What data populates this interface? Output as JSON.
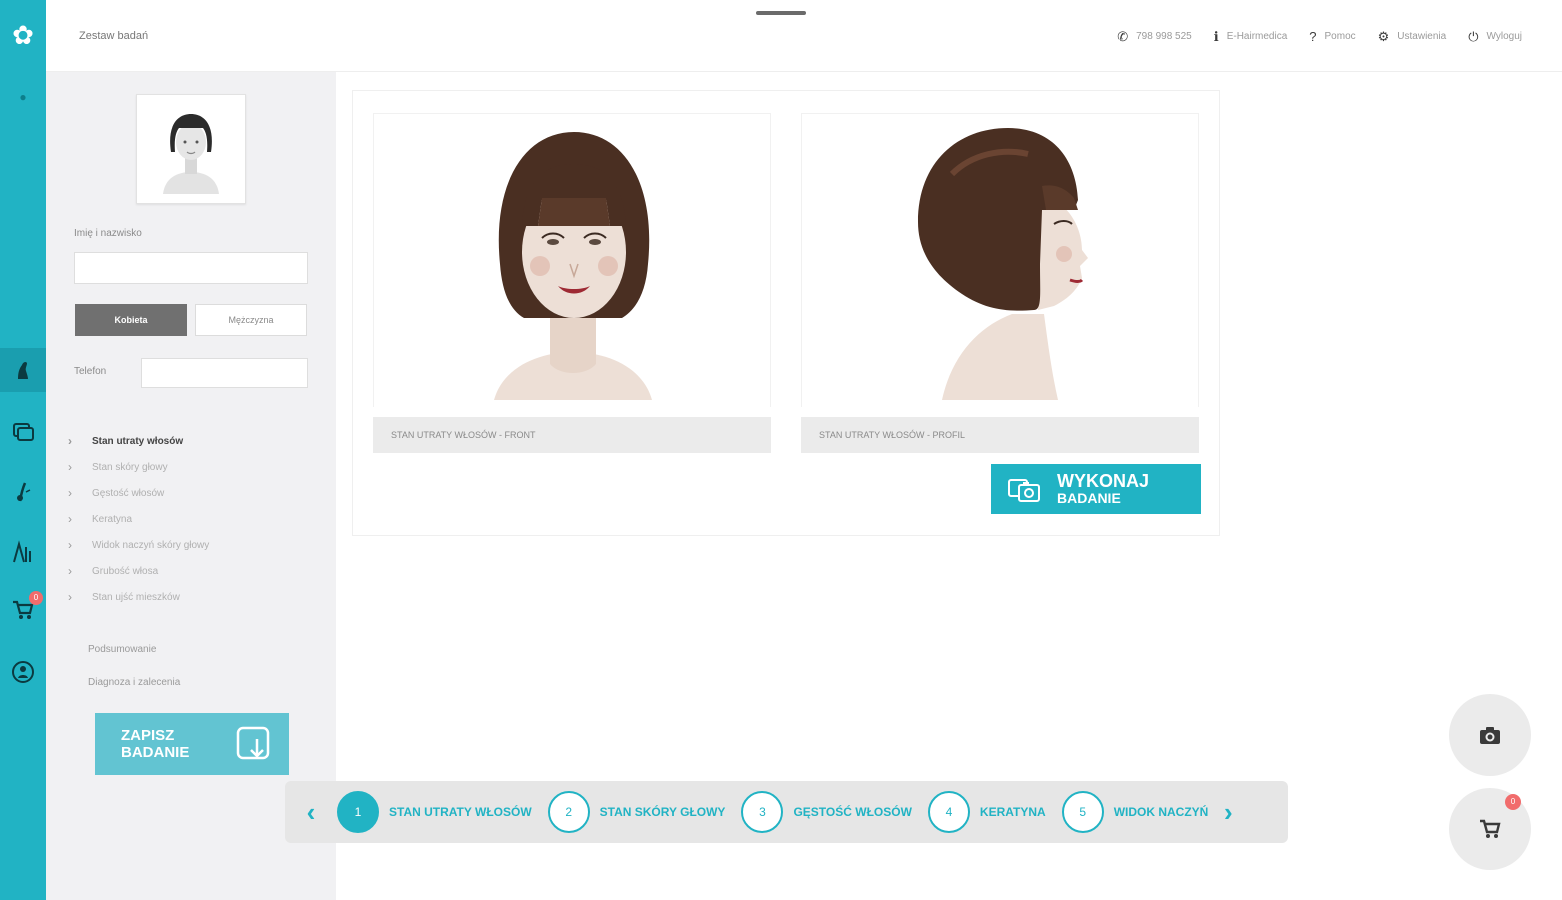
{
  "topbar": {
    "page_title": "Zestaw badań",
    "nav": [
      {
        "icon": "phone-icon",
        "label": "798 998 525"
      },
      {
        "icon": "info-icon",
        "label": "E-Hairmedica"
      },
      {
        "icon": "help-icon",
        "label": "Pomoc"
      },
      {
        "icon": "user-settings-icon",
        "label": "Ustawienia"
      },
      {
        "icon": "power-icon",
        "label": "Wyloguj"
      }
    ]
  },
  "rail": {
    "cart_badge": "0"
  },
  "sidepanel": {
    "name_label": "Imię i nazwisko",
    "name_value": "",
    "gender_female": "Kobieta",
    "gender_male": "Mężczyzna",
    "phone_label": "Telefon",
    "phone_value": "",
    "steps": [
      "Stan utraty włosów",
      "Stan skóry głowy",
      "Gęstość włosów",
      "Keratyna",
      "Widok naczyń skóry głowy",
      "Grubość włosa",
      "Stan ujść mieszków"
    ],
    "summary_link": "Podsumowanie",
    "diagnosis_link": "Diagnoza i zalecenia",
    "save_line1": "ZAPISZ",
    "save_line2": "BADANIE"
  },
  "main": {
    "front_caption": "STAN UTRATY WŁOSÓW - FRONT",
    "profile_caption": "STAN UTRATY WŁOSÓW - PROFIL",
    "run_line1": "WYKONAJ",
    "run_line2": "BADANIE"
  },
  "stepper": {
    "steps": [
      {
        "num": "1",
        "label": "STAN UTRATY WŁOSÓW"
      },
      {
        "num": "2",
        "label": "STAN SKÓRY GŁOWY"
      },
      {
        "num": "3",
        "label": "GĘSTOŚĆ WŁOSÓW"
      },
      {
        "num": "4",
        "label": "KERATYNA"
      },
      {
        "num": "5",
        "label": "WIDOK NACZYŃ"
      }
    ]
  },
  "fab": {
    "cart_badge": "0"
  },
  "colors": {
    "accent": "#21b3c4",
    "accent_light": "#62c4d2",
    "badge": "#f16c6c",
    "hair": "#4a2f22",
    "skin": "#eddfd6"
  }
}
